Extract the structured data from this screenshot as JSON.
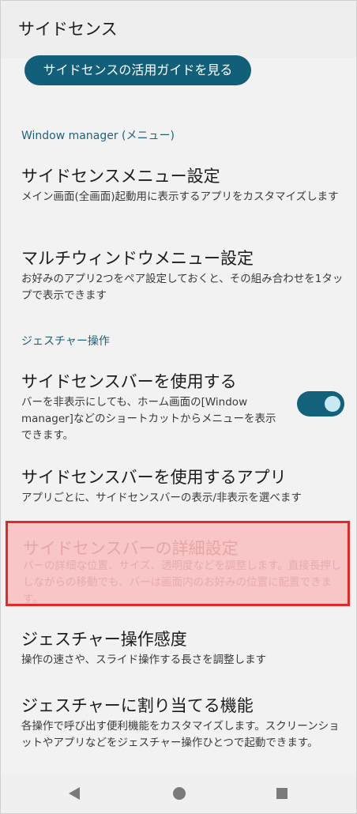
{
  "app_bar": {
    "title": "サイドセンス"
  },
  "guide_button": {
    "label": "サイドセンスの活用ガイドを見る"
  },
  "sections": {
    "window_manager": "Window manager (メニュー)",
    "gesture": "ジェスチャー操作"
  },
  "items": {
    "sidesense_menu": {
      "title": "サイドセンスメニュー設定",
      "desc": "メイン画面(全画面)起動用に表示するアプリをカスタマイズします"
    },
    "multiwindow_menu": {
      "title": "マルチウィンドウメニュー設定",
      "desc": "お好みのアプリ2つをペア設定しておくと、その組み合わせを1タップで表示できます"
    },
    "use_bar": {
      "title": "サイドセンスバーを使用する",
      "desc": "バーを非表示にしても、ホーム画面の[Window manager]などのショートカットからメニューを表示できます。",
      "toggle_on": true
    },
    "apps_using_bar": {
      "title": "サイドセンスバーを使用するアプリ",
      "desc": "アプリごとに、サイドセンスバーの表示/非表示を選べます"
    },
    "bar_detail": {
      "title": "サイドセンスバーの詳細設定",
      "desc": "バーの詳細な位置、サイズ、透明度などを調整します。直接長押ししながらの移動でも、バーは画面内のお好みの位置に配置できます。"
    },
    "gesture_sensitivity": {
      "title": "ジェスチャー操作感度",
      "desc": "操作の速さや、スライド操作する長さを調整します"
    },
    "gesture_functions": {
      "title": "ジェスチャーに割り当てる機能",
      "desc": "各操作で呼び出す便利機能をカスタマイズします。スクリーンショットやアプリなどをジェスチャー操作ひとつで起動できます。"
    }
  },
  "colors": {
    "accent": "#115f78",
    "section_header": "#21627a",
    "highlight_fill": "#f8c6c6",
    "highlight_border": "#e02a2a"
  },
  "nav_icons": [
    "back-icon",
    "home-icon",
    "recents-icon"
  ]
}
